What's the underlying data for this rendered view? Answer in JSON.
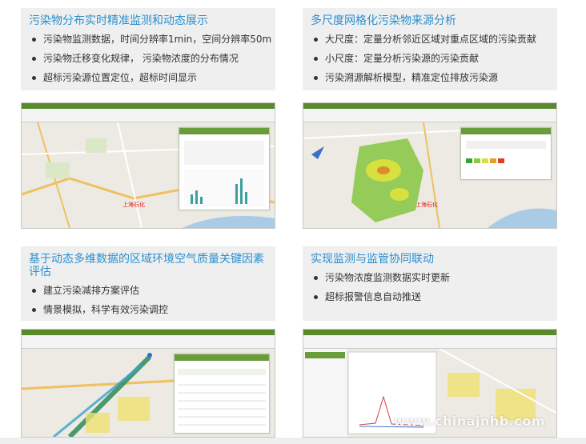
{
  "panels": [
    {
      "title": "污染物分布实时精准监测和动态展示",
      "items": [
        "污染物监测数据，时间分辨率1min，空间分辨率50m",
        "污染物迁移变化规律， 污染物浓度的分布情况",
        "超标污染源位置定位，超标时间显示"
      ]
    },
    {
      "title": "多尺度网格化污染物来源分析",
      "items": [
        "大尺度：定量分析邻近区域对重点区域的污染贡献",
        "小尺度：定量分析污染源的污染贡献",
        "污染溯源解析模型，精准定位排放污染源"
      ]
    },
    {
      "title": "基于动态多维数据的区域环境空气质量关键因素评估",
      "items": [
        "建立污染减排方案评估",
        "情景模拟，科学有效污染调控"
      ]
    },
    {
      "title": "实现监测与监管协同联动",
      "items": [
        "污染物浓度监测数据实时更新",
        "超标报警信息自动推送"
      ]
    }
  ],
  "screenshots": [
    {
      "map_label": "上海石化"
    },
    {
      "map_label": "上海石化"
    },
    {
      "map_label": ""
    },
    {
      "map_label": ""
    }
  ],
  "watermark": "www.chinajnhb.com"
}
